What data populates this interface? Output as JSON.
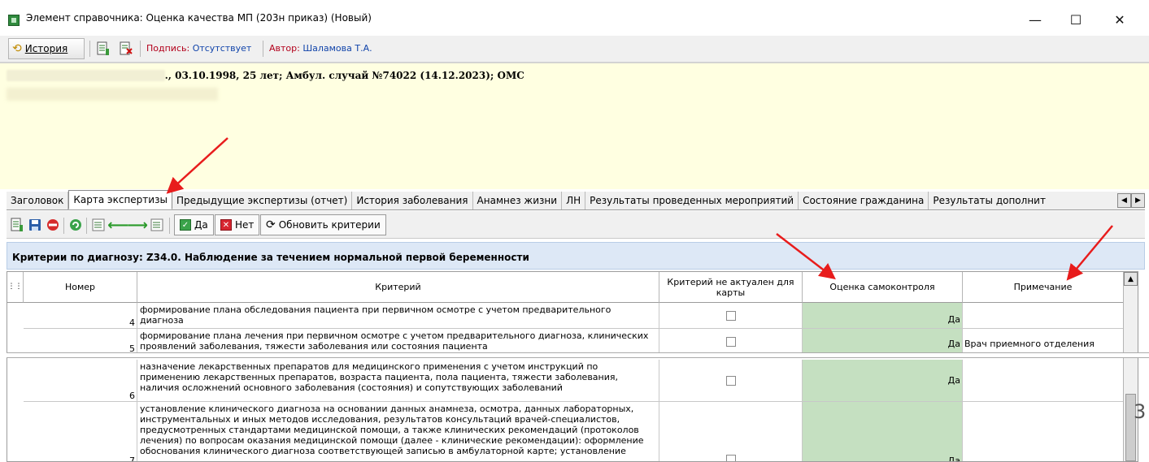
{
  "window": {
    "title": "Элемент справочника: Оценка качества МП (203н приказ) (Новый)",
    "controls": [
      "—",
      "☐",
      "✕"
    ]
  },
  "toolbar": {
    "history_label": "История",
    "signature_label": "Подпись:",
    "signature_value": "Отсутствует",
    "author_label": "Автор:",
    "author_value": "Шаламова Т.А."
  },
  "patient": {
    "line1": "., 03.10.1998, 25 лет; Амбул. случай №74022 (14.12.2023); ОМС"
  },
  "tabs": [
    {
      "label": "Заголовок"
    },
    {
      "label": "Карта экспертизы"
    },
    {
      "label": "Предыдущие экспертизы (отчет)"
    },
    {
      "label": "История заболевания"
    },
    {
      "label": "Анамнез жизни"
    },
    {
      "label": "ЛН"
    },
    {
      "label": "Результаты проведенных мероприятий"
    },
    {
      "label": "Состояние гражданина"
    },
    {
      "label": "Результаты дополнит"
    }
  ],
  "toolbar2": {
    "yes_label": "Да",
    "no_label": "Нет",
    "refresh_label": "Обновить критерии"
  },
  "criteria_header": "Критерии по диагнозу: Z34.0. Наблюдение за течением нормальной первой беременности",
  "table": {
    "columns": [
      "Номер",
      "Критерий",
      "Критерий не актуален для карты",
      "Оценка самоконтроля",
      "Примечание"
    ],
    "rows": [
      {
        "num": "4",
        "crit": "формирование плана обследования пациента при первичном осмотре с учетом предварительного диагноза",
        "score": "Да",
        "note": ""
      },
      {
        "num": "5",
        "crit": "формирование плана лечения при первичном осмотре с учетом предварительного диагноза, клинических проявлений заболевания, тяжести заболевания или состояния пациента",
        "score": "Да",
        "note": "Врач приемного отделения"
      },
      {
        "num": "6",
        "crit": "назначение лекарственных препаратов для медицинского применения с учетом инструкций по применению лекарственных препаратов, возраста пациента, пола пациента, тяжести заболевания, наличия осложнений основного заболевания (состояния) и сопутствующих заболеваний",
        "score": "Да",
        "note": ""
      },
      {
        "num": "7",
        "crit": "установление клинического диагноза на основании данных анамнеза, осмотра, данных лабораторных, инструментальных и иных методов исследования, результатов консультаций врачей-специалистов, предусмотренных стандартами медицинской помощи, а также клинических рекомендаций (протоколов лечения) по вопросам оказания медицинской помощи (далее - клинические рекомендации): оформление обоснования клинического диагноза соответствующей записью в амбулаторной карте; установление",
        "score": "Да",
        "note": ""
      }
    ]
  },
  "side_mark": "3"
}
